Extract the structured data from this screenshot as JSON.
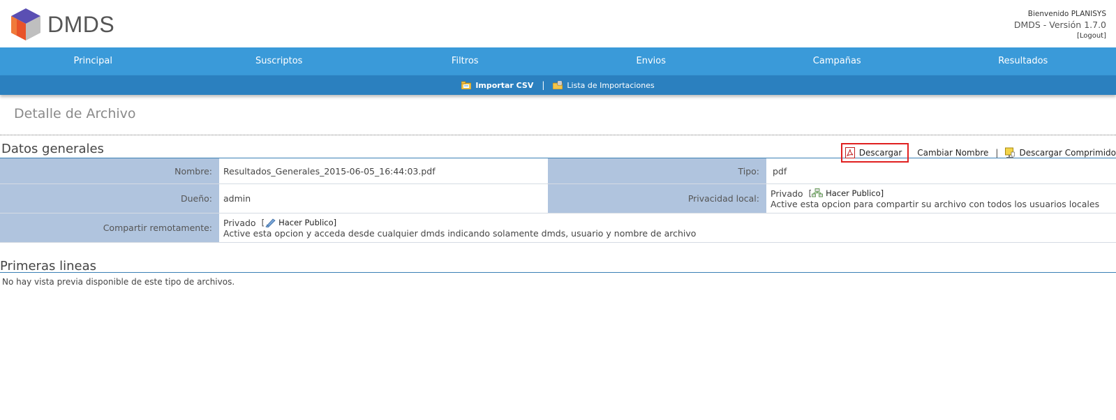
{
  "header": {
    "app_name": "DMDS",
    "welcome": "Bienvenido PLANISYS",
    "version": "DMDS - Versión 1.7.0",
    "logout": "[Logout]"
  },
  "nav": {
    "items": [
      "Principal",
      "Suscriptos",
      "Filtros",
      "Envios",
      "Campañas",
      "Resultados"
    ]
  },
  "subnav": {
    "import_csv": "Importar CSV",
    "separator": "|",
    "imports_list": "Lista de Importaciones"
  },
  "page": {
    "title": "Detalle de Archivo"
  },
  "general": {
    "title": "Datos generales",
    "actions": {
      "download": "Descargar",
      "rename": "Cambiar Nombre",
      "separator": "|",
      "download_zip": "Descargar Comprimido"
    },
    "fields": {
      "name_label": "Nombre:",
      "name_value": "Resultados_Generales_2015-06-05_16:44:03.pdf",
      "type_label": "Tipo:",
      "type_value": "pdf",
      "owner_label": "Dueño:",
      "owner_value": "admin",
      "local_privacy_label": "Privacidad local:",
      "local_privacy_status": "Privado",
      "local_privacy_link": "Hacer Publico]",
      "local_privacy_bracket": "[",
      "local_privacy_hint": "Active esta opcion para compartir su archivo con todos los usuarios locales",
      "remote_label": "Compartir remotamente:",
      "remote_status": "Privado",
      "remote_bracket": "[",
      "remote_link": "Hacer Publico]",
      "remote_hint": "Active esta opcion y acceda desde cualquier dmds indicando solamente dmds, usuario y nombre de archivo"
    }
  },
  "preview": {
    "title": "Primeras lineas",
    "message": "No hay vista previa disponible de este tipo de archivos."
  },
  "colors": {
    "nav": "#3a9ad9",
    "subnav": "#2b80bf",
    "label_bg": "#b0c4de",
    "highlight": "#e02020"
  }
}
